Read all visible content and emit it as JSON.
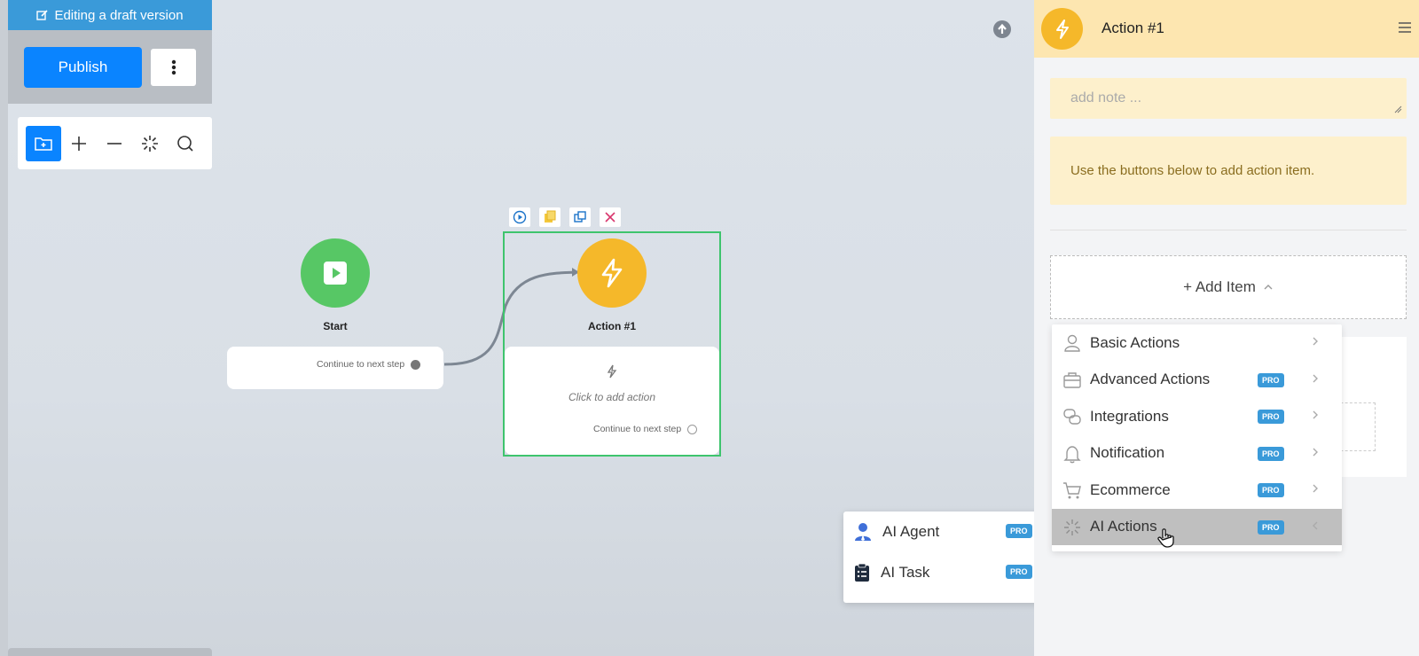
{
  "draft": {
    "label": "Editing a draft version"
  },
  "toolbar": {
    "publish_label": "Publish"
  },
  "canvas": {
    "start_node": {
      "title": "Start",
      "continue": "Continue to next step"
    },
    "action_node": {
      "title": "Action #1",
      "click_add": "Click to add action",
      "continue": "Continue to next step"
    }
  },
  "submenu": {
    "items": [
      {
        "label": "AI Agent",
        "badge": "PRO",
        "icon": "ai-agent-icon"
      },
      {
        "label": "AI Task",
        "badge": "PRO",
        "icon": "clipboard-list-icon"
      }
    ]
  },
  "panel": {
    "title": "Action #1",
    "note_placeholder": "add note ...",
    "info": "Use the buttons below to add action item.",
    "add_item": "+ Add Item",
    "menu": [
      {
        "label": "Basic Actions",
        "badge": "",
        "icon": "user-icon"
      },
      {
        "label": "Advanced Actions",
        "badge": "PRO",
        "icon": "briefcase-icon"
      },
      {
        "label": "Integrations",
        "badge": "PRO",
        "icon": "integrations-icon"
      },
      {
        "label": "Notification",
        "badge": "PRO",
        "icon": "bell-icon"
      },
      {
        "label": "Ecommerce",
        "badge": "PRO",
        "icon": "cart-icon"
      },
      {
        "label": "AI Actions",
        "badge": "PRO",
        "icon": "sparkle-icon"
      }
    ]
  },
  "colors": {
    "accent": "#0a84ff",
    "start": "#57c765",
    "action": "#f5b82a",
    "pro": "#3a9ad9",
    "frame": "#3ec46d"
  }
}
